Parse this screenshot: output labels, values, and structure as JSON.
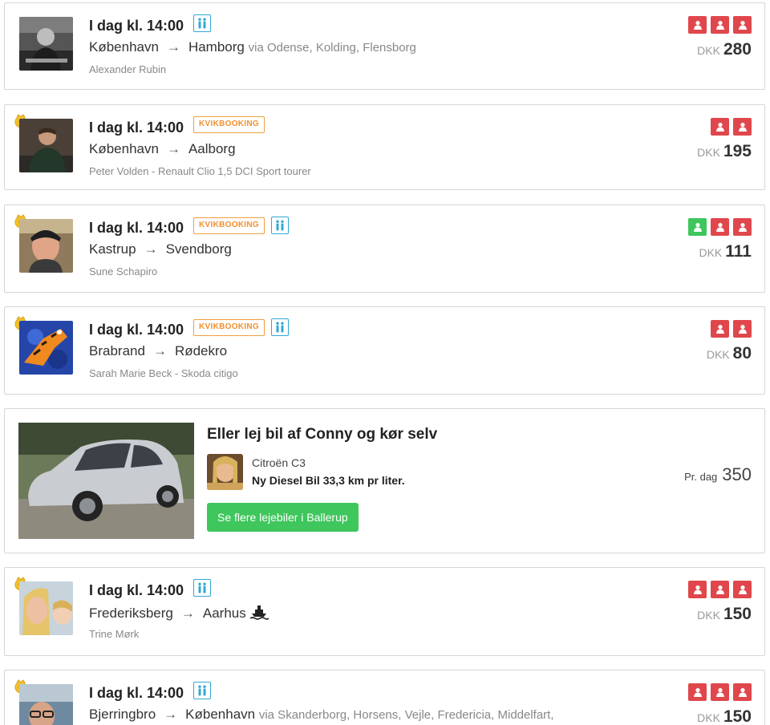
{
  "colors": {
    "seat_taken": "#e0474c",
    "seat_free": "#3fc65d",
    "ladies_accent": "#31a9d3",
    "kvik_accent": "#f0a040"
  },
  "rides": [
    {
      "time": "I dag kl. 14:00",
      "from": "København",
      "arrow": "→",
      "to": "Hamborg",
      "via": "via Odense, Kolding, Flensborg",
      "driver": "Alexander Rubin",
      "currency": "DKK",
      "price": "280",
      "seats": [
        "taken",
        "taken",
        "taken"
      ],
      "kvikbooking": false,
      "ladies_only": true,
      "ferry": false,
      "badge": false,
      "avatar": "avatar-man-canoe"
    },
    {
      "time": "I dag kl. 14:00",
      "from": "København",
      "arrow": "→",
      "to": "Aalborg",
      "via": "",
      "driver": "Peter Volden - Renault Clio 1,5 DCI Sport tourer",
      "currency": "DKK",
      "price": "195",
      "seats": [
        "taken",
        "taken"
      ],
      "kvikbooking": true,
      "kvik_label": "KVIKBOOKING",
      "ladies_only": false,
      "ferry": false,
      "badge": true,
      "avatar": "avatar-man-couch"
    },
    {
      "time": "I dag kl. 14:00",
      "from": "Kastrup",
      "arrow": "→",
      "to": "Svendborg",
      "via": "",
      "driver": "Sune Schapiro",
      "currency": "DKK",
      "price": "111",
      "seats": [
        "free",
        "taken",
        "taken"
      ],
      "kvikbooking": true,
      "kvik_label": "KVIKBOOKING",
      "ladies_only": true,
      "ferry": false,
      "badge": true,
      "avatar": "avatar-man-cap"
    },
    {
      "time": "I dag kl. 14:00",
      "from": "Brabrand",
      "arrow": "→",
      "to": "Rødekro",
      "via": "",
      "driver": "Sarah Marie Beck - Skoda citigo",
      "currency": "DKK",
      "price": "80",
      "seats": [
        "taken",
        "taken"
      ],
      "kvikbooking": true,
      "kvik_label": "KVIKBOOKING",
      "ladies_only": true,
      "ferry": false,
      "badge": true,
      "avatar": "avatar-tigger"
    },
    {
      "time": "I dag kl. 14:00",
      "from": "Frederiksberg",
      "arrow": "→",
      "to": "Aarhus",
      "via": "",
      "driver": "Trine Mørk",
      "currency": "DKK",
      "price": "150",
      "seats": [
        "taken",
        "taken",
        "taken"
      ],
      "kvikbooking": false,
      "ladies_only": true,
      "ferry": true,
      "badge": true,
      "avatar": "avatar-woman-selfie"
    },
    {
      "time": "I dag kl. 14:00",
      "from": "Bjerringbro",
      "arrow": "→",
      "to": "København",
      "via": "via Skanderborg, Horsens, Vejle, Fredericia, Middelfart,",
      "driver": "",
      "currency": "DKK",
      "price": "150",
      "seats": [
        "taken",
        "taken",
        "taken"
      ],
      "kvikbooking": false,
      "ladies_only": true,
      "ferry": false,
      "badge": true,
      "avatar": "avatar-man-glasses"
    }
  ],
  "rental": {
    "title": "Eller lej bil af Conny og kør selv",
    "car_model": "Citroën C3",
    "description": "Ny Diesel Bil 33,3 km pr liter.",
    "button_label": "Se flere lejebiler i Ballerup",
    "per_day_label": "Pr. dag",
    "price": "350"
  }
}
